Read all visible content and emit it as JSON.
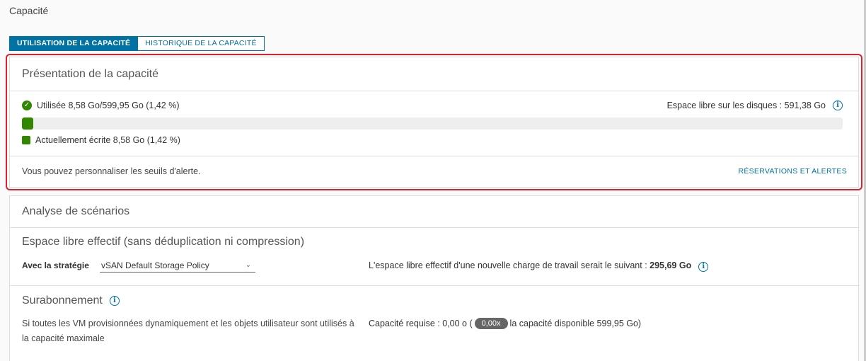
{
  "page": {
    "title": "Capacité"
  },
  "tabs": [
    {
      "label": "UTILISATION DE LA CAPACITÉ",
      "active": true
    },
    {
      "label": "HISTORIQUE DE LA CAPACITÉ",
      "active": false
    }
  ],
  "overview": {
    "title": "Présentation de la capacité",
    "used_label": "Utilisée 8,58 Go/599,95 Go (1,42 %)",
    "free_label": "Espace libre sur les disques : 591,38 Go",
    "used_fraction": 0.0142,
    "legend_label": "Actuellement écrite 8,58 Go (1,42 %)",
    "footer_text": "Vous pouvez personnaliser les seuils d'alerte.",
    "footer_link": "RÉSERVATIONS ET ALERTES"
  },
  "scenario": {
    "title": "Analyse de scénarios",
    "effective": {
      "title": "Espace libre effectif (sans déduplication ni compression)",
      "policy_label": "Avec la stratégie",
      "policy_value": "vSAN Default Storage Policy",
      "result_prefix": "L'espace libre effectif d'une nouvelle charge de travail serait le suivant : ",
      "result_value": "295,69 Go"
    },
    "oversub": {
      "title": "Surabonnement",
      "description": "Si toutes les VM provisionnées dynamiquement et les objets utilisateur sont utilisés à la capacité maximale",
      "req_prefix": "Capacité requise : 0,00 o (",
      "ratio": "0,00x",
      "req_suffix": " la capacité disponible 599,95 Go)"
    }
  },
  "colors": {
    "accent": "#0072a3",
    "success": "#318700",
    "alert_outline": "#d9232f"
  }
}
